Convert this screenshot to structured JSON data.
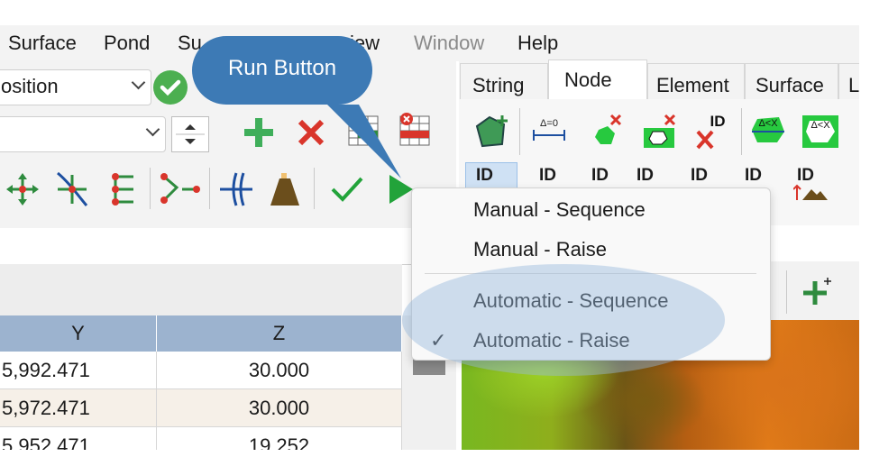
{
  "menu": {
    "items": [
      {
        "label": "Surface",
        "disabled": false
      },
      {
        "label": "Pond",
        "disabled": false
      },
      {
        "label": "Su",
        "disabled": false
      },
      {
        "label": "iew",
        "disabled": false
      },
      {
        "label": "Window",
        "disabled": true
      },
      {
        "label": "Help",
        "disabled": false
      }
    ]
  },
  "toolbar": {
    "combo1_value": "osition",
    "combo2_value": ""
  },
  "callout": {
    "label": "Run Button"
  },
  "tabs": [
    {
      "label": "String",
      "active": false
    },
    {
      "label": "Node",
      "active": true
    },
    {
      "label": "Element",
      "active": false
    },
    {
      "label": "Surface",
      "active": false
    },
    {
      "label": "L",
      "active": false
    }
  ],
  "ribbon": {
    "id_label": "ID",
    "delta_label_1": "Δ=0",
    "delta_label_2": "Δ<X"
  },
  "dropdown": {
    "items": [
      {
        "label": "Manual  - Sequence",
        "checked": false
      },
      {
        "label": "Manual  - Raise",
        "checked": false
      },
      {
        "label": "Automatic  - Sequence",
        "checked": false
      },
      {
        "label": "Automatic  - Raise",
        "checked": true
      }
    ],
    "check_glyph": "✓"
  },
  "table": {
    "columns": [
      "Y",
      "Z"
    ],
    "rows": [
      [
        "5,992.471",
        "30.000"
      ],
      [
        "5,972.471",
        "30.000"
      ],
      [
        "5,952.471",
        "19.252"
      ]
    ]
  },
  "colors": {
    "accent": "#3d7ab5",
    "run_green": "#22a33a",
    "delete_red": "#d9352b",
    "header_blue": "#9cb3cf"
  }
}
